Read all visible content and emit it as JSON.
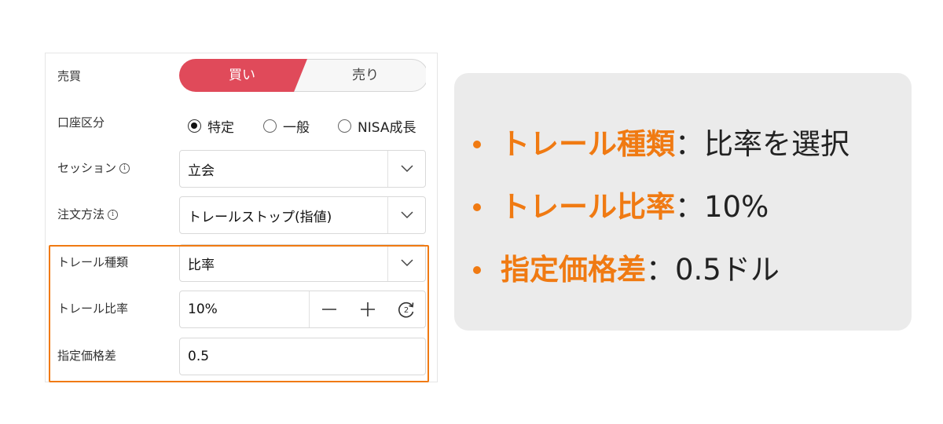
{
  "form": {
    "trade": {
      "label": "売買",
      "buy": "買い",
      "sell": "売り",
      "selected": "buy",
      "buy_color": "#e04a5a"
    },
    "account": {
      "label": "口座区分",
      "options": [
        "特定",
        "一般",
        "NISA成長"
      ],
      "selected": "特定"
    },
    "session": {
      "label": "セッション",
      "info_icon": "ⓘ",
      "value": "立会"
    },
    "order_method": {
      "label": "注文方法",
      "info_icon": "ⓘ",
      "value": "トレールストップ(指値)"
    },
    "trail_type": {
      "label": "トレール種類",
      "value": "比率"
    },
    "trail_ratio": {
      "label": "トレール比率",
      "value": "10%"
    },
    "price_diff": {
      "label": "指定価格差",
      "value": "0.5"
    },
    "highlight_color": "#f07a12"
  },
  "card": {
    "items": [
      {
        "key": "トレール種類",
        "colon": "：",
        "value": "比率を選択"
      },
      {
        "key": "トレール比率",
        "colon": "：",
        "value": "10%"
      },
      {
        "key": "指定価格差",
        "colon": "：",
        "value": "0.5ドル"
      }
    ],
    "accent_color": "#f07a12",
    "background": "#ebebeb"
  }
}
